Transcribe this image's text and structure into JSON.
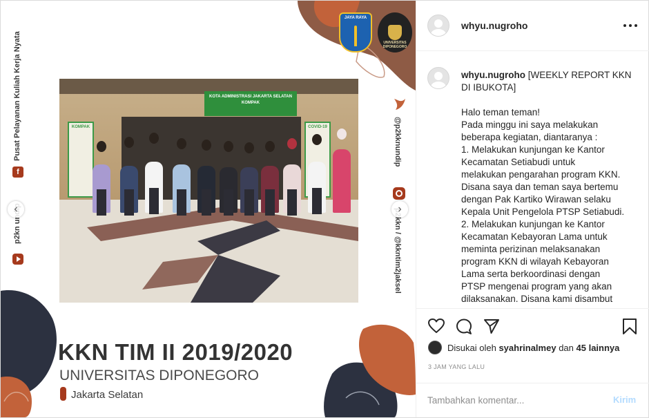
{
  "post": {
    "side_left_text": "Pusat Pelayanan Kuliah Kerja Nyata",
    "side_left_handle": "p2kn undip",
    "side_right_handle_1": "@p2kknundip",
    "side_right_handle_2": "p2kkn / @kkntim2jaksel",
    "logo_dki_text": "JAYA RAYA",
    "logo_undip_text": "UNIVERSITAS DIPONEGORO",
    "sign_text": "KOTA ADMINISTRASI JAKARTA SELATAN KOMPAK",
    "banner_left_text": "KOMPAK",
    "banner_right_text": "COVID-19",
    "title": "KKN TIM II 2019/2020",
    "university": "UNIVERSITAS DIPONEGORO",
    "location": "Jakarta Selatan",
    "prev_arrow": "‹",
    "next_arrow": "›"
  },
  "header": {
    "username": "whyu.nugroho"
  },
  "caption": {
    "username": "whyu.nugroho",
    "title": "[WEEKLY REPORT KKN DI IBUKOTA]",
    "greeting": "Halo teman teman!",
    "body": "Pada minggu ini saya melakukan beberapa kegiatan, diantaranya : 1. Melakukan kunjungan ke Kantor Kecamatan Setiabudi untuk melakukan pengarahan program KKN. Disana saya dan teman saya bertemu dengan Pak Kartiko Wirawan selaku Kepala Unit Pengelola PTSP Setiabudi. 2. Melakukan kunjungan ke Kantor Kecamatan Kebayoran Lama untuk meminta perizinan melaksanakan program KKN di wilayah Kebayoran Lama serta berkoordinasi dengan PTSP mengenai program yang akan dilaksanakan. Disana kami disambut"
  },
  "caption_lines": [
    "Pada minggu ini saya melakukan",
    "beberapa kegiatan, diantaranya :",
    "1. Melakukan kunjungan ke Kantor",
    "Kecamatan Setiabudi untuk",
    "melakukan pengarahan program KKN.",
    "Disana saya dan teman saya bertemu",
    "dengan Pak Kartiko Wirawan selaku",
    "Kepala Unit Pengelola PTSP Setiabudi.",
    "2. Melakukan kunjungan ke Kantor",
    "Kecamatan Kebayoran Lama untuk",
    "meminta perizinan melaksanakan",
    "program KKN di wilayah Kebayoran",
    "Lama serta berkoordinasi dengan",
    "PTSP mengenai program yang akan",
    "dilaksanakan. Disana kami disambut"
  ],
  "likes": {
    "prefix": "Disukai oleh",
    "user": "syahrinalmey",
    "conjunction": "dan",
    "others": "45 lainnya"
  },
  "timestamp": "3 JAM YANG LALU",
  "comment": {
    "placeholder": "Tambahkan komentar...",
    "post_label": "Kirim"
  },
  "icons": {
    "like": "heart-icon",
    "comment": "comment-icon",
    "share": "share-icon",
    "save": "bookmark-icon",
    "more": "more-icon"
  },
  "colors": {
    "accent_orange": "#c2623a",
    "accent_brown": "#8e5b45",
    "deco_navy": "#2c3140",
    "post_button": "#b3dbff"
  }
}
